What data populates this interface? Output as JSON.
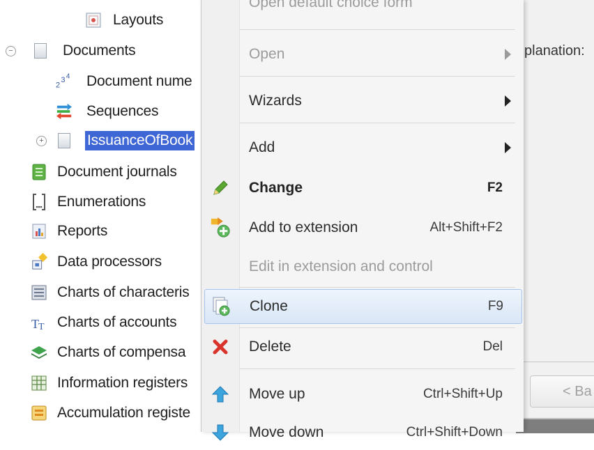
{
  "tree": {
    "items": [
      {
        "label": "Layouts",
        "icon": "layout-icon"
      },
      {
        "label": "Documents",
        "icon": "document-icon"
      },
      {
        "label": "Document nume",
        "icon": "numbering-icon"
      },
      {
        "label": "Sequences",
        "icon": "sequences-icon"
      },
      {
        "label": "IssuanceOfBook",
        "icon": "document-icon"
      },
      {
        "label": "Document journals",
        "icon": "journal-icon"
      },
      {
        "label": "Enumerations",
        "icon": "enumeration-icon"
      },
      {
        "label": "Reports",
        "icon": "report-icon"
      },
      {
        "label": "Data processors",
        "icon": "data-processor-icon"
      },
      {
        "label": "Charts of characteris",
        "icon": "chart-of-characteristics-icon"
      },
      {
        "label": "Charts of accounts",
        "icon": "chart-of-accounts-icon"
      },
      {
        "label": "Charts of compensa",
        "icon": "chart-of-compensation-icon"
      },
      {
        "label": "Information registers",
        "icon": "information-register-icon"
      },
      {
        "label": "Accumulation registe",
        "icon": "accumulation-register-icon"
      }
    ]
  },
  "menu": {
    "top_cut": "Open default choice form",
    "items": {
      "open": {
        "label": "Open",
        "state": "disabled"
      },
      "wizards": {
        "label": "Wizards"
      },
      "add": {
        "label": "Add"
      },
      "change": {
        "label": "Change",
        "shortcut": "F2",
        "icon": "pencil-icon"
      },
      "add_to_extension": {
        "label": "Add to extension",
        "shortcut": "Alt+Shift+F2",
        "icon": "add-to-extension-icon"
      },
      "edit_in_extension": {
        "label": "Edit in extension and control",
        "state": "disabled"
      },
      "clone": {
        "label": "Clone",
        "shortcut": "F9",
        "icon": "clone-icon",
        "state": "highlighted"
      },
      "delete": {
        "label": "Delete",
        "shortcut": "Del",
        "icon": "delete-x-icon"
      },
      "move_up": {
        "label": "Move up",
        "shortcut": "Ctrl+Shift+Up",
        "icon": "move-up-icon"
      },
      "move_down": {
        "label": "Move down",
        "shortcut": "Ctrl+Shift+Down",
        "icon": "move-down-icon"
      }
    }
  },
  "background": {
    "explanation_text": "planation:",
    "back_button": "< Ba"
  },
  "colors": {
    "selection": "#3e66d4",
    "highlight_border": "#a8c4ea",
    "delete_red": "#d9342b",
    "pencil_green": "#5aa832"
  }
}
